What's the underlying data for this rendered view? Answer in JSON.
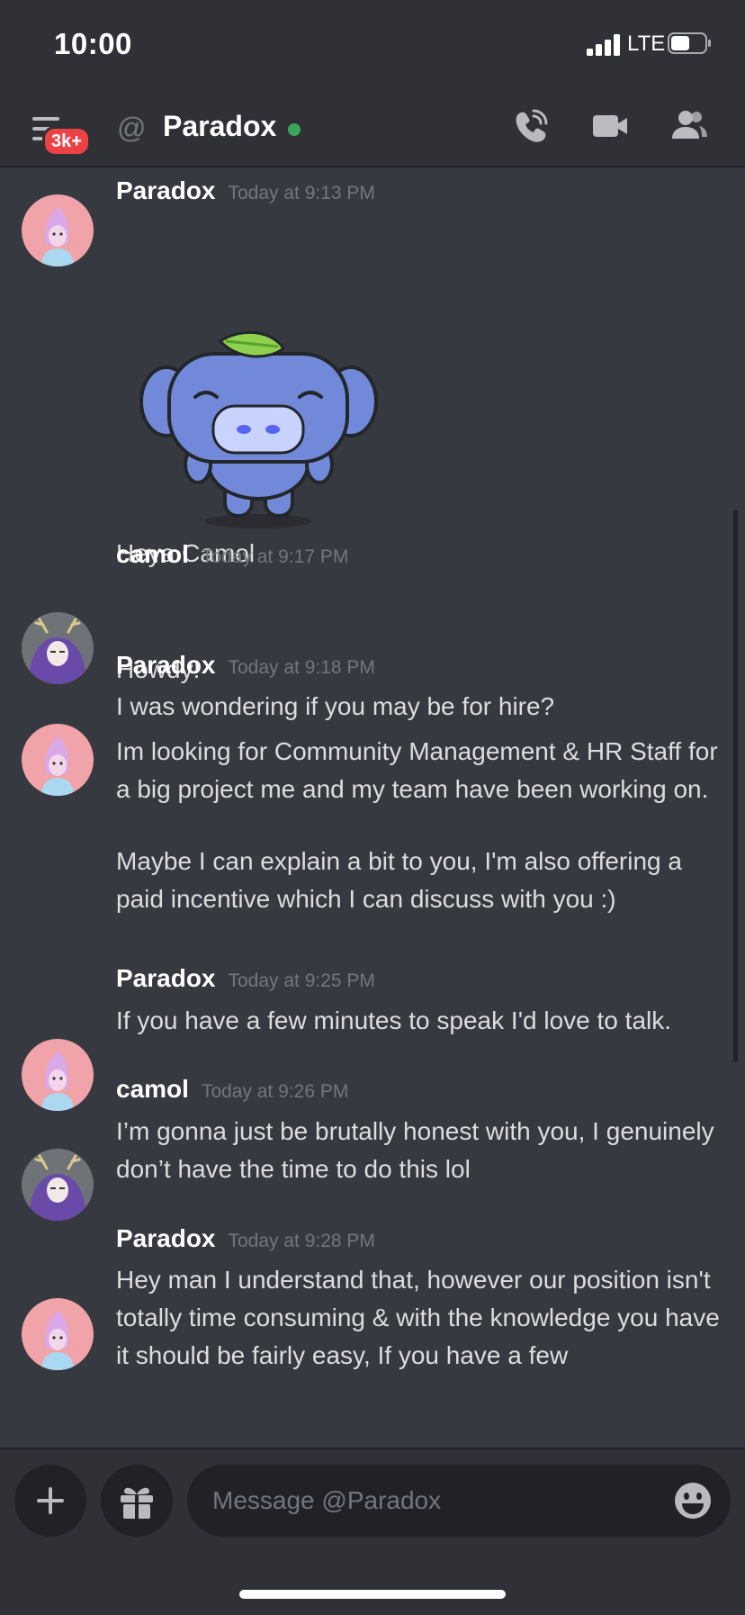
{
  "status_bar": {
    "time": "10:00",
    "network": "LTE"
  },
  "header": {
    "badge": "3k+",
    "channel_name": "Paradox",
    "status_color": "#3ba55d"
  },
  "messages": [
    {
      "author": "Paradox",
      "timestamp": "Today at 9:13 PM",
      "sticker": "wumpus-leaf-sticker",
      "lines": [
        "Heya Camol"
      ]
    },
    {
      "author": "camol",
      "timestamp": "Today at 9:17 PM",
      "lines": [
        "Howdy!"
      ]
    },
    {
      "author": "Paradox",
      "timestamp": "Today at 9:18 PM",
      "lines": [
        "I was wondering if you may be for hire?",
        "Im looking for Community Management & HR Staff for a big project me and my team have been working on.",
        "Maybe I can explain a bit to you, I'm also offering a paid incentive which I can discuss with you :)"
      ]
    },
    {
      "author": "Paradox",
      "timestamp": "Today at 9:25 PM",
      "lines": [
        "If you have a few minutes to speak I'd love to talk."
      ]
    },
    {
      "author": "camol",
      "timestamp": "Today at 9:26 PM",
      "lines": [
        "I’m gonna just be brutally honest with you, I genuinely don’t have the time to do this lol"
      ]
    },
    {
      "author": "Paradox",
      "timestamp": "Today at 9:28 PM",
      "lines": [
        "Hey man I understand that, however our position isn't totally time consuming & with the knowledge you have it should be fairly easy, If you have a few"
      ]
    }
  ],
  "composer": {
    "placeholder": "Message @Paradox"
  },
  "colors": {
    "background": "#36393f",
    "header": "#2f3136",
    "input": "#202225",
    "badge": "#ed4245",
    "text": "#dcddde",
    "muted": "#72767d"
  }
}
